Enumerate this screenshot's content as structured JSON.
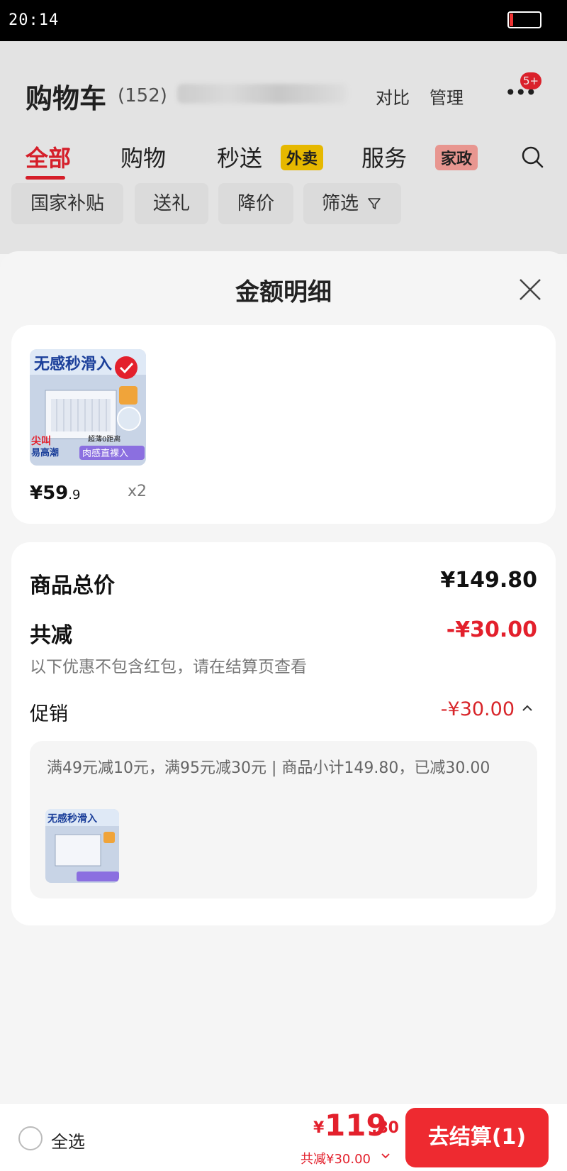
{
  "status": {
    "time": "20:14",
    "battery_level": 0.12
  },
  "header": {
    "title": "购物车",
    "count": "(152)",
    "compare": "对比",
    "manage": "管理",
    "more_badge": "5+"
  },
  "tabs": [
    {
      "label": "全部",
      "active": true
    },
    {
      "label": "购物",
      "tag": ""
    },
    {
      "label": "秒送",
      "tag": "外卖"
    },
    {
      "label": "服务",
      "tag": "家政"
    }
  ],
  "filters": [
    "国家补贴",
    "送礼",
    "降价",
    "筛选"
  ],
  "sheet": {
    "title": "金额明细",
    "product": {
      "price_main": "¥59",
      "price_decimal": ".9",
      "quantity": "x2",
      "image_text": {
        "line1": "无感秒滑入",
        "corner1": "尖叫",
        "corner2": "易高潮",
        "sub": "超薄0距离",
        "badge": "肉感直裸入"
      }
    },
    "summary": {
      "goods_total_label": "商品总价",
      "goods_total_value": "¥149.80",
      "reduction_label": "共减",
      "reduction_value": "-¥30.00",
      "reduction_note": "以下优惠不包含红包，请在结算页查看",
      "promo_label": "促销",
      "promo_value": "-¥30.00",
      "promo_detail": "满49元减10元，满95元减30元 | 商品小计149.80，已减30.00"
    }
  },
  "bottom": {
    "select_all": "全选",
    "yen": "¥",
    "total_int": "119",
    "total_dec": ".80",
    "total_sub": "共减¥30.00",
    "checkout": "去结算(1)"
  },
  "colors": {
    "accent": "#e3202c",
    "checkout_bg": "#ee2a30",
    "tag_yellow": "#f5c400",
    "tag_pink": "#f7a09a"
  }
}
